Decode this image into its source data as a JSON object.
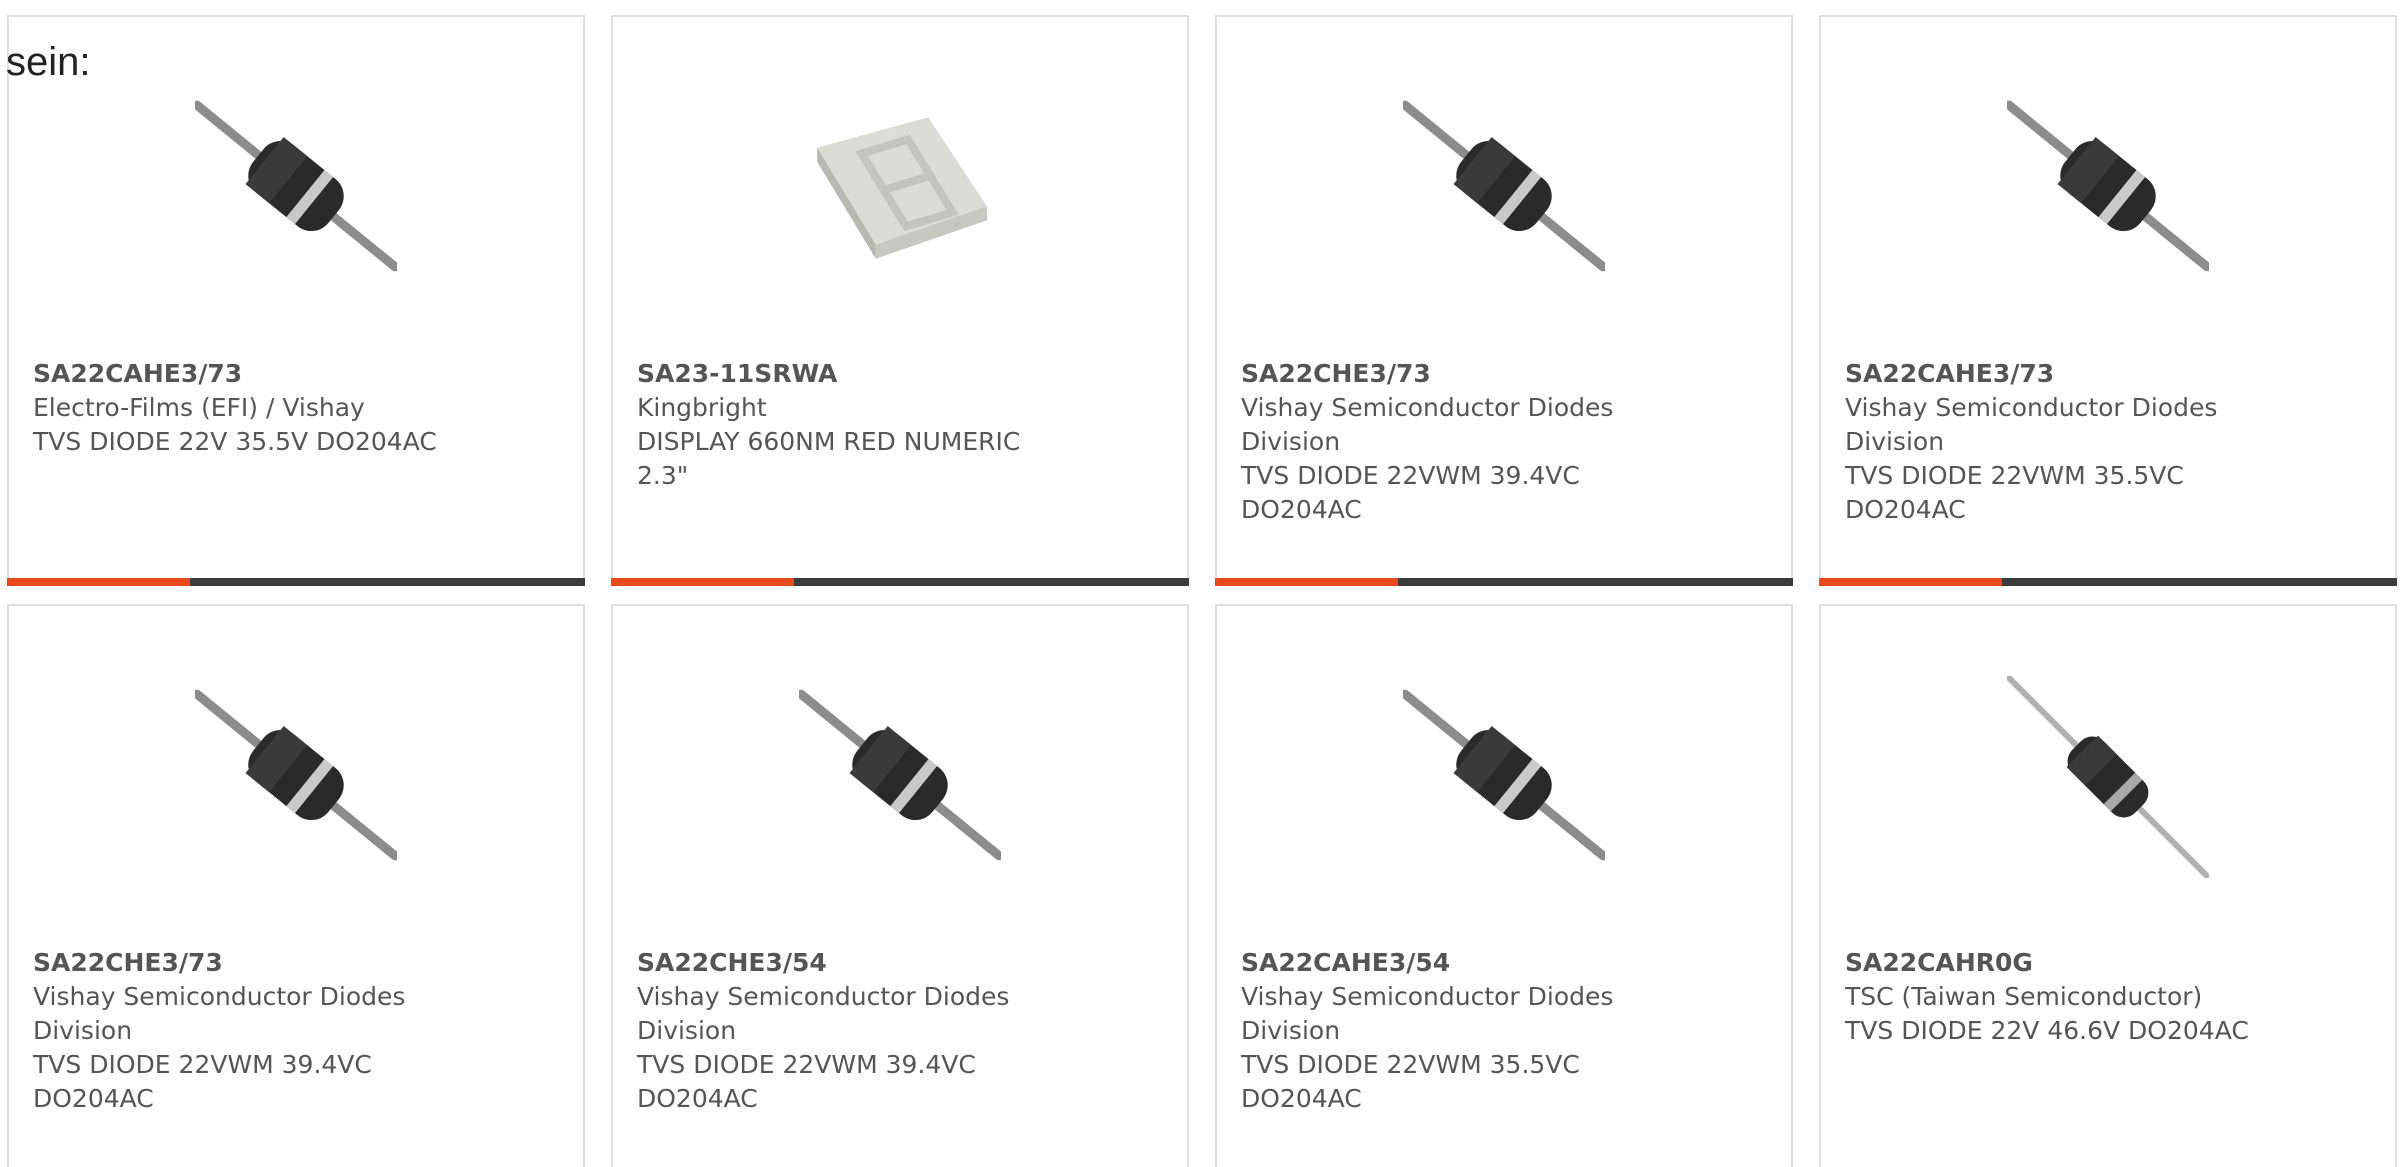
{
  "intro_text": "sein:",
  "colors": {
    "accent": "#e8491d",
    "bar": "#3c3c3c",
    "text": "#555555",
    "border": "#e0e0e0"
  },
  "products": [
    {
      "part": "SA22CAHE3/73",
      "manufacturer": "Electro-Films (EFI) / Vishay",
      "description": "TVS DIODE 22V 35.5V DO204AC",
      "icon": "diode-icon"
    },
    {
      "part": "SA23-11SRWA",
      "manufacturer": "Kingbright",
      "description": "DISPLAY 660NM RED NUMERIC 2.3\"",
      "icon": "seven-segment-display-icon"
    },
    {
      "part": "SA22CHE3/73",
      "manufacturer": "Vishay Semiconductor Diodes Division",
      "description": "TVS DIODE 22VWM 39.4VC DO204AC",
      "icon": "diode-icon"
    },
    {
      "part": "SA22CAHE3/73",
      "manufacturer": "Vishay Semiconductor Diodes Division",
      "description": "TVS DIODE 22VWM 35.5VC DO204AC",
      "icon": "diode-icon"
    },
    {
      "part": "SA22CHE3/73",
      "manufacturer": "Vishay Semiconductor Diodes Division",
      "description": "TVS DIODE 22VWM 39.4VC DO204AC",
      "icon": "diode-icon"
    },
    {
      "part": "SA22CHE3/54",
      "manufacturer": "Vishay Semiconductor Diodes Division",
      "description": "TVS DIODE 22VWM 39.4VC DO204AC",
      "icon": "diode-icon"
    },
    {
      "part": "SA22CAHE3/54",
      "manufacturer": "Vishay Semiconductor Diodes Division",
      "description": "TVS DIODE 22VWM 35.5VC DO204AC",
      "icon": "diode-icon"
    },
    {
      "part": "SA22CAHR0G",
      "manufacturer": "TSC (Taiwan Semiconductor)",
      "description": "TVS DIODE 22V 46.6V DO204AC",
      "icon": "diode-icon"
    }
  ]
}
